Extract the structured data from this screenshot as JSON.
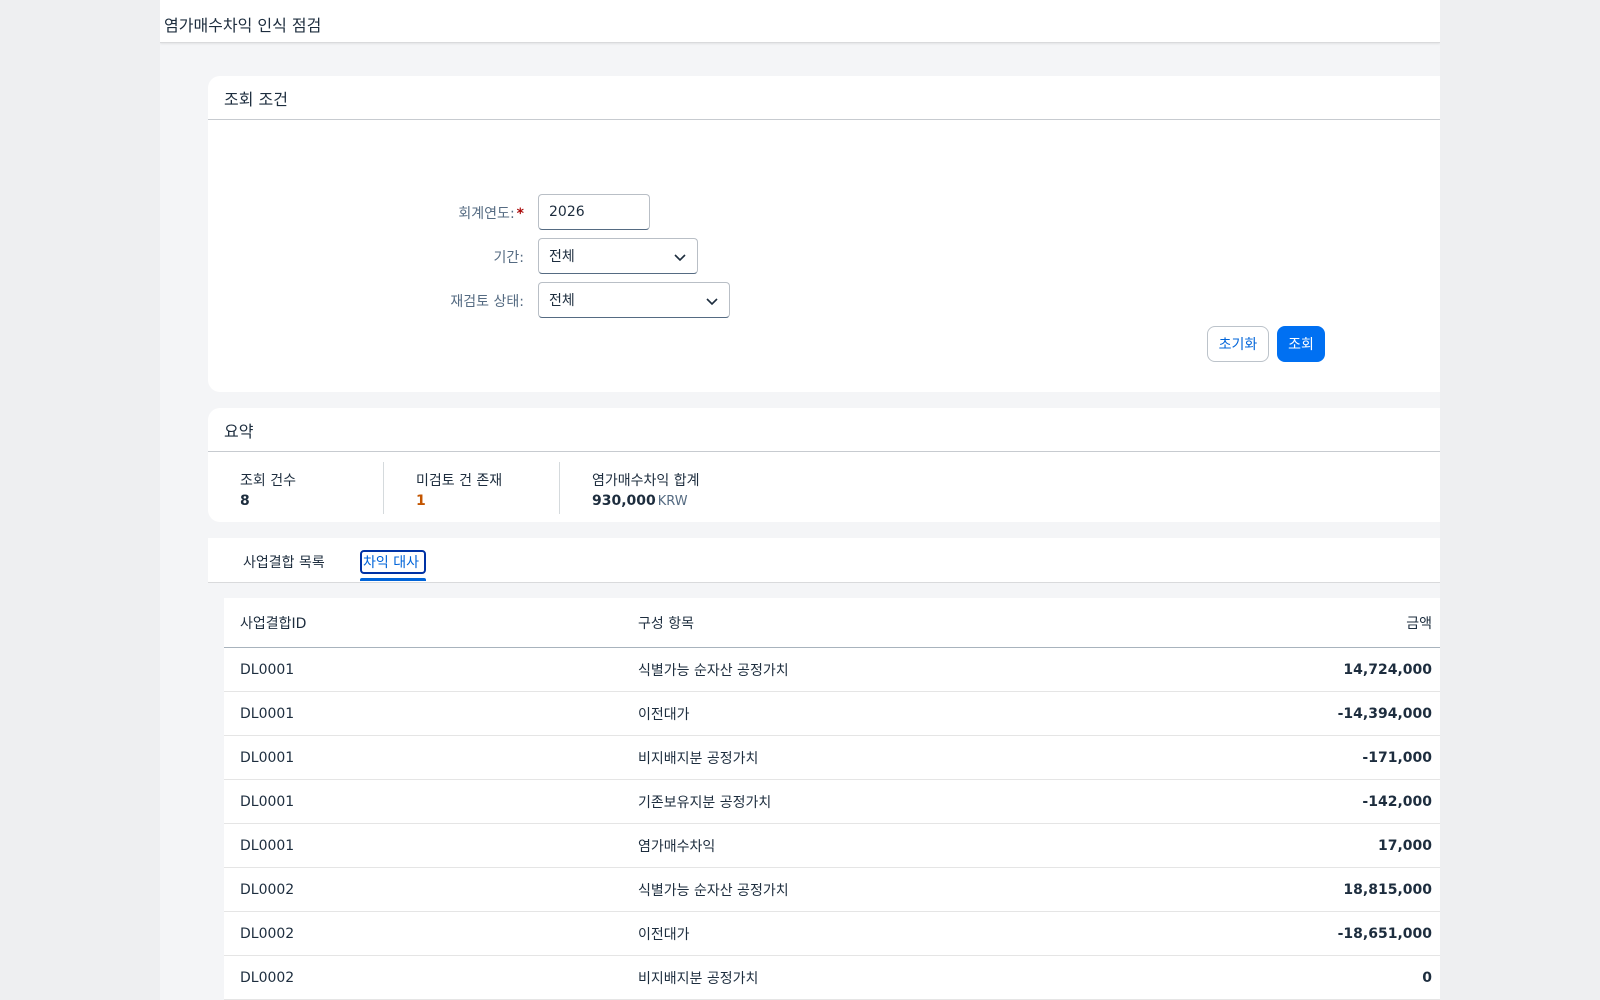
{
  "shell": {
    "title": "염가매수차익 인식 점검"
  },
  "filter": {
    "header": "조회 조건",
    "fiscal_year_label": "회계연도:",
    "required_mark": "*",
    "fiscal_year_value": "2026",
    "period_label": "기간:",
    "period_value": "전체",
    "review_status_label": "재검토 상태:",
    "review_status_value": "전체",
    "reset_label": "초기화",
    "search_label": "조회"
  },
  "summary": {
    "header": "요약",
    "kpis": [
      {
        "label": "조회 건수",
        "value": "8"
      },
      {
        "label": "미검토 건 존재",
        "value": "1"
      },
      {
        "label": "염가매수차익 합계",
        "value": "930,000",
        "unit": "KRW"
      }
    ]
  },
  "tabs": [
    {
      "label": "사업결합 목록",
      "active": false
    },
    {
      "label": "차익 대사",
      "active": true
    }
  ],
  "table": {
    "columns": [
      "사업결합ID",
      "구성 항목",
      "금액"
    ],
    "rows": [
      {
        "id": "DL0001",
        "item": "식별가능 순자산 공정가치",
        "amount": "14,724,000"
      },
      {
        "id": "DL0001",
        "item": "이전대가",
        "amount": "-14,394,000"
      },
      {
        "id": "DL0001",
        "item": "비지배지분 공정가치",
        "amount": "-171,000"
      },
      {
        "id": "DL0001",
        "item": "기존보유지분 공정가치",
        "amount": "-142,000"
      },
      {
        "id": "DL0001",
        "item": "염가매수차익",
        "amount": "17,000"
      },
      {
        "id": "DL0002",
        "item": "식별가능 순자산 공정가치",
        "amount": "18,815,000"
      },
      {
        "id": "DL0002",
        "item": "이전대가",
        "amount": "-18,651,000"
      },
      {
        "id": "DL0002",
        "item": "비지배지분 공정가치",
        "amount": "0"
      }
    ]
  },
  "colors": {
    "accent": "#0070f2",
    "warning": "#c35500",
    "text": "#1d2d3e"
  }
}
